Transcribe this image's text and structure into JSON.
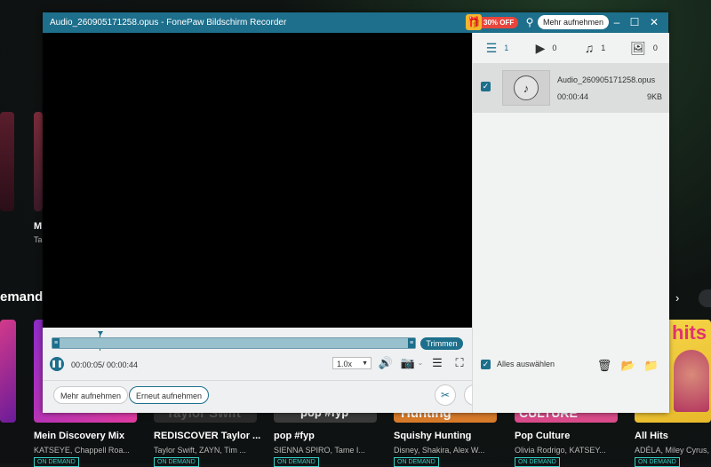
{
  "window": {
    "title": "Audio_260905171258.opus  -  FonePaw Bildschirm Recorder",
    "promo_badge": "30% OFF",
    "more_record_top": "Mehr aufnehmen",
    "icons": {
      "pin": "pin-icon",
      "minimize": "minimize-icon",
      "maximize": "maximize-icon",
      "close": "close-icon"
    }
  },
  "filters": [
    {
      "icon": "list-icon",
      "count": "1"
    },
    {
      "icon": "video-icon",
      "count": "0"
    },
    {
      "icon": "music-icon",
      "count": "1"
    },
    {
      "icon": "image-icon",
      "count": "0"
    }
  ],
  "file": {
    "name": "Audio_260905171258.opus",
    "duration": "00:00:44",
    "size": "9KB"
  },
  "select_all": "Alles auswählen",
  "trim": "Trimmen",
  "time_display": "00:00:05/ 00:00:44",
  "speed": "1.0x",
  "playback_progress": 0.11,
  "bottom": {
    "more_record": "Mehr aufnehmen",
    "rerecord": "Erneut aufnehmen"
  },
  "tools": [
    "scissors-icon",
    "merge-icon",
    "convert-icon",
    "compress-icon",
    "edit-icon",
    "audio-share-icon",
    "volume-boost-icon",
    "more-icon"
  ],
  "background": {
    "section": "emand",
    "cards": [
      {
        "title": "Mein Discovery Mix",
        "sub": "KATSEYE, Chappell Roa..."
      },
      {
        "title": "REDISCOVER Taylor ...",
        "sub": "Taylor Swift, ZAYN, Tim ..."
      },
      {
        "title": "pop #fyp",
        "sub": "SIENNA SPIRO, Tame I..."
      },
      {
        "title": "Squishy Hunting",
        "sub": "Disney, Shakira, Alex W..."
      },
      {
        "title": "Pop Culture",
        "sub": "Olivia Rodrigo, KATSEY..."
      },
      {
        "title": "All Hits",
        "sub": "ADÉLA, Miley Cyrus, ..."
      }
    ],
    "left_card_title": "M",
    "left_card_sub": "Ta",
    "tile_texts": {
      "hits": "hits",
      "pop": "pop #fyp",
      "hunting": "Hunting",
      "culture": "CULTURE",
      "taylor": "Taylor Swift"
    },
    "badge": "ON DEMAND"
  }
}
